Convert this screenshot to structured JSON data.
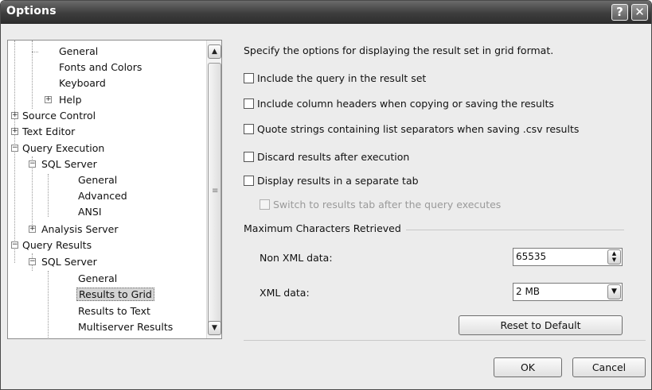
{
  "window": {
    "title": "Options",
    "help_label": "?",
    "close_label": "✕"
  },
  "tree": {
    "items": [
      {
        "label": "General",
        "expander": ""
      },
      {
        "label": "Fonts and Colors",
        "expander": ""
      },
      {
        "label": "Keyboard",
        "expander": ""
      },
      {
        "label": "Help",
        "expander": "+"
      },
      {
        "label": "Source Control",
        "expander": "+"
      },
      {
        "label": "Text Editor",
        "expander": "+"
      },
      {
        "label": "Query Execution",
        "expander": "−"
      },
      {
        "label": "SQL Server",
        "expander": "−"
      },
      {
        "label": "General",
        "expander": ""
      },
      {
        "label": "Advanced",
        "expander": ""
      },
      {
        "label": "ANSI",
        "expander": ""
      },
      {
        "label": "Analysis Server",
        "expander": "+"
      },
      {
        "label": "Query Results",
        "expander": "−"
      },
      {
        "label": "SQL Server",
        "expander": "−"
      },
      {
        "label": "General",
        "expander": ""
      },
      {
        "label": "Results to Grid",
        "expander": "",
        "selected": true
      },
      {
        "label": "Results to Text",
        "expander": ""
      },
      {
        "label": "Multiserver Results",
        "expander": ""
      }
    ],
    "scroll_up": "▲",
    "scroll_down": "▼"
  },
  "panel": {
    "intro": "Specify the options for displaying the result set in grid format.",
    "options": [
      {
        "label": "Include the query in the result set",
        "checked": false
      },
      {
        "label": "Include column headers when copying or saving the results",
        "checked": false
      },
      {
        "label": "Quote strings containing list separators when saving .csv results",
        "checked": false
      },
      {
        "label": "Discard results after execution",
        "checked": false
      },
      {
        "label": "Display results in a separate tab",
        "checked": false
      },
      {
        "label": "Switch to results tab after the query executes",
        "checked": false,
        "disabled": true
      }
    ],
    "group_title": "Maximum Characters Retrieved",
    "non_xml_label": "Non XML data:",
    "non_xml_value": "65535",
    "xml_label": "XML data:",
    "xml_value": "2 MB",
    "reset_label": "Reset to Default"
  },
  "footer": {
    "ok_label": "OK",
    "cancel_label": "Cancel"
  }
}
